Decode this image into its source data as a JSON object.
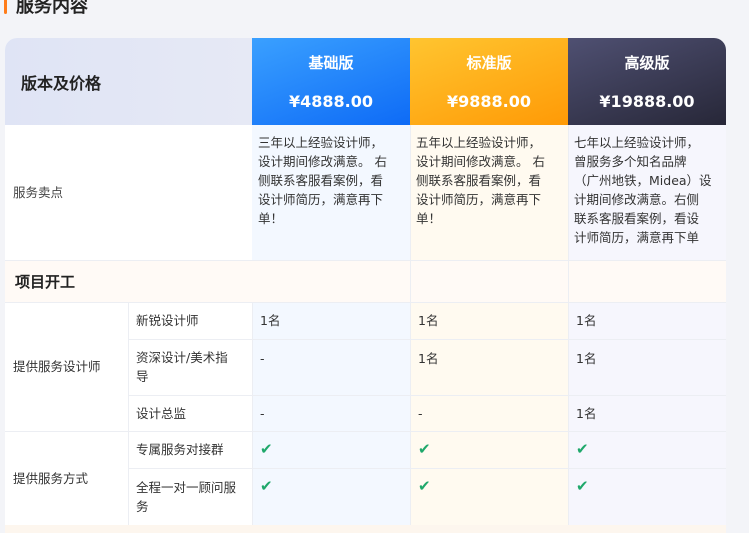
{
  "section": {
    "title": "服务内容"
  },
  "header": {
    "label": "版本及价格",
    "plans": [
      {
        "name": "基础版",
        "price": "¥4888.00"
      },
      {
        "name": "标准版",
        "price": "¥9888.00"
      },
      {
        "name": "高级版",
        "price": "¥19888.00"
      }
    ]
  },
  "selling": {
    "label": "服务卖点",
    "basic": [
      "三年以上经验设计师，",
      "设计期间修改满意。 右",
      "侧联系客服看案例，看",
      "设计师简历，满意再下",
      "单！"
    ],
    "standard": [
      "五年以上经验设计师，",
      "设计期间修改满意。 右",
      "侧联系客服看案例，看",
      "设计师简历，满意再下",
      "单！"
    ],
    "pro": [
      "七年以上经验设计师，",
      "曾服务多个知名品牌",
      "（广州地铁，Midea）设",
      "计期间修改满意。右侧",
      "联系客服看案例，看设",
      "计师简历，满意再下单"
    ]
  },
  "group": {
    "title": "项目开工"
  },
  "rows": {
    "designer_category": "提供服务设计师",
    "r1": {
      "feature": "新锐设计师",
      "basic": "1名",
      "standard": "1名",
      "pro": "1名"
    },
    "r2": {
      "feature_l1": "资深设计/美术指",
      "feature_l2": "导",
      "basic": "-",
      "standard": "1名",
      "pro": "1名"
    },
    "r3": {
      "feature": "设计总监",
      "basic": "-",
      "standard": "-",
      "pro": "1名"
    },
    "method_category": "提供服务方式",
    "r4": {
      "feature": "专属服务对接群",
      "basic": "✔",
      "standard": "✔",
      "pro": "✔"
    },
    "r5": {
      "feature_l1": "全程一对一顾问服",
      "feature_l2": "务",
      "basic": "✔",
      "standard": "✔",
      "pro": "✔"
    }
  },
  "colors": {
    "accent": "#ff7d1a",
    "basic": "#1677ff",
    "standard": "#ffa31a",
    "pro": "#2f2f45",
    "check": "#1fa86b"
  }
}
